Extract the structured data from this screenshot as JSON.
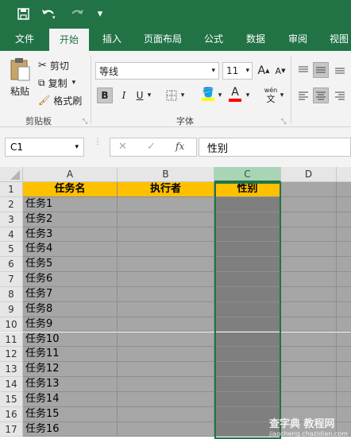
{
  "qat": {
    "save_icon": "save-icon",
    "undo_icon": "undo-icon",
    "redo_icon": "redo-icon",
    "customize": "▾"
  },
  "tabs": [
    {
      "label": "文件"
    },
    {
      "label": "开始"
    },
    {
      "label": "插入"
    },
    {
      "label": "页面布局"
    },
    {
      "label": "公式"
    },
    {
      "label": "数据"
    },
    {
      "label": "审阅"
    },
    {
      "label": "视图"
    }
  ],
  "ribbon": {
    "clipboard": {
      "paste": "粘贴",
      "cut": "剪切",
      "copy": "复制",
      "format_painter": "格式刷",
      "group_label": "剪贴板"
    },
    "font": {
      "font_name": "等线",
      "font_size": "11",
      "bold": "B",
      "italic": "I",
      "underline": "U",
      "grow": "A",
      "shrink": "A",
      "font_color_letter": "A",
      "wen": "wén",
      "wen_char": "文",
      "group_label": "字体"
    }
  },
  "formula_bar": {
    "name_box": "C1",
    "cancel": "✕",
    "enter": "✓",
    "fx": "fx",
    "value": "性别"
  },
  "grid": {
    "columns": [
      "A",
      "B",
      "C",
      "D"
    ],
    "selected_column": "C",
    "header_row": {
      "a": "任务名",
      "b": "执行者",
      "c": "性别"
    },
    "rows": [
      {
        "num": "1"
      },
      {
        "num": "2",
        "a": "任务1"
      },
      {
        "num": "3",
        "a": "任务2"
      },
      {
        "num": "4",
        "a": "任务3"
      },
      {
        "num": "5",
        "a": "任务4"
      },
      {
        "num": "6",
        "a": "任务5"
      },
      {
        "num": "7",
        "a": "任务6"
      },
      {
        "num": "8",
        "a": "任务7"
      },
      {
        "num": "9",
        "a": "任务8"
      },
      {
        "num": "10",
        "a": "任务9"
      },
      {
        "num": "11",
        "a": "任务10"
      },
      {
        "num": "12",
        "a": "任务11"
      },
      {
        "num": "13",
        "a": "任务12"
      },
      {
        "num": "14",
        "a": "任务13"
      },
      {
        "num": "15",
        "a": "任务14"
      },
      {
        "num": "16",
        "a": "任务15"
      },
      {
        "num": "17",
        "a": "任务16"
      }
    ]
  },
  "watermark": {
    "line1": "查字典 教程网",
    "line2": "jiaocheng.chazidian.com"
  },
  "colors": {
    "title_bar": "#217346",
    "header_fill": "#ffc000",
    "cell_gray": "#a6a6a6",
    "selected_col": "#7f7f7f"
  }
}
